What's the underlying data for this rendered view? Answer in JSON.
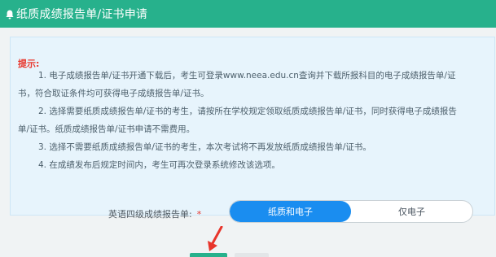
{
  "header": {
    "icon": "bell-icon",
    "title": "纸质成绩报告单/证书申请",
    "color": "#27b18c"
  },
  "notice": {
    "heading": "提示:",
    "lines": [
      "1. 电子成绩报告单/证书开通下载后，考生可登录www.neea.edu.cn查询并下载所报科目的电子成绩报告单/证",
      "书，符合取证条件均可获得电子成绩报告单/证书。",
      "2. 选择需要纸质成绩报告单/证书的考生，请按所在学校规定领取纸质成绩报告单/证书，同时获得电子成绩报告",
      "单/证书。纸质成绩报告单/证书申请不需费用。",
      "3. 选择不需要纸质成绩报告单/证书的考生，本次考试将不再发放纸质成绩报告单/证书。",
      "4. 在成绩发布后规定时间内，考生可再次登录系统修改该选项。"
    ]
  },
  "form": {
    "label": "英语四级成绩报告单:",
    "required_mark": "*",
    "options": [
      "纸质和电子",
      "仅电子"
    ],
    "selected": "纸质和电子",
    "accent": "#1a8df0"
  },
  "annotation": {
    "arrow_icon": "red-arrow-icon",
    "arrow_color": "#e8352b"
  }
}
